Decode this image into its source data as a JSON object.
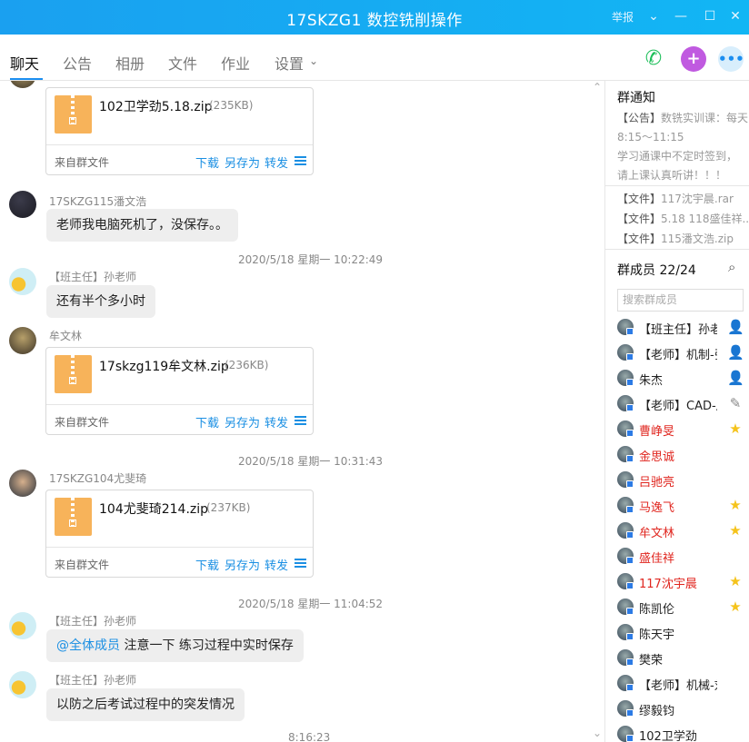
{
  "window": {
    "title": "17SKZG1 数控铣削操作",
    "report_label": "举报"
  },
  "tabs": [
    {
      "label": "聊天"
    },
    {
      "label": "公告"
    },
    {
      "label": "相册"
    },
    {
      "label": "文件"
    },
    {
      "label": "作业"
    },
    {
      "label": "设置"
    }
  ],
  "file_common": {
    "source": "来自群文件",
    "download": "下载",
    "save_as": "另存为",
    "forward": "转发"
  },
  "messages": {
    "file1": {
      "name": "102卫学劲5.18.zip",
      "size": "(235KB)"
    },
    "m2": {
      "sender": "17SKZG115潘文浩",
      "text": "老师我电脑死机了，没保存。。"
    },
    "t1": "2020/5/18 星期一 10:22:49",
    "m3": {
      "sender": "【班主任】孙老师",
      "text": "还有半个多小时"
    },
    "m4": {
      "sender": "牟文林",
      "file_name": "17skzg119牟文林.zip",
      "file_size": "(236KB)"
    },
    "t2": "2020/5/18 星期一 10:31:43",
    "m5": {
      "sender": "17SKZG104尤斐琦",
      "file_name": "104尤斐琦214.zip",
      "file_size": "(237KB)"
    },
    "t3": "2020/5/18 星期一 11:04:52",
    "m6": {
      "sender": "【班主任】孙老师",
      "mention": "@全体成员",
      "text": " 注意一下 练习过程中实时保存"
    },
    "m7": {
      "sender": "【班主任】孙老师",
      "text": "以防之后考试过程中的突发情况"
    },
    "t4": "8:16:23"
  },
  "notice": {
    "title": "群通知",
    "items": [
      {
        "tag": "【公告】",
        "text": "数铣实训课：每天"
      },
      {
        "tag": "",
        "text": "8:15～11:15"
      },
      {
        "tag": "",
        "text": "学习通课中不定时签到，"
      },
      {
        "tag": "",
        "text": "请上课认真听讲！！！"
      },
      {
        "tag": "【文件】",
        "text": "117沈宇晨.rar"
      },
      {
        "tag": "【文件】",
        "text": "5.18 118盛佳祥..."
      },
      {
        "tag": "【文件】",
        "text": "115潘文浩.zip"
      }
    ]
  },
  "members": {
    "title": "群成员 22/24",
    "search_placeholder": "搜索群成员",
    "list": [
      {
        "name": "【班主任】孙老师",
        "red": false,
        "icon": "person-icon"
      },
      {
        "name": "【老师】机制-张",
        "red": false,
        "icon": "person-icon"
      },
      {
        "name": "朱杰",
        "red": false,
        "icon": "person-icon"
      },
      {
        "name": "【老师】CAD-周",
        "red": false,
        "icon": "pencil-icon"
      },
      {
        "name": "曹峥旻",
        "red": true,
        "icon": "star-icon"
      },
      {
        "name": "金思诚",
        "red": true,
        "icon": ""
      },
      {
        "name": "吕驰亮",
        "red": true,
        "icon": ""
      },
      {
        "name": "马逸飞",
        "red": true,
        "icon": "star-icon"
      },
      {
        "name": "牟文林",
        "red": true,
        "icon": "star-icon"
      },
      {
        "name": "盛佳祥",
        "red": true,
        "icon": ""
      },
      {
        "name": "117沈宇晨",
        "red": true,
        "icon": "star-icon"
      },
      {
        "name": "陈凯伦",
        "red": false,
        "icon": "star-icon"
      },
      {
        "name": "陈天宇",
        "red": false,
        "icon": ""
      },
      {
        "name": "樊荣",
        "red": false,
        "icon": ""
      },
      {
        "name": "【老师】机械-刘老师",
        "red": false,
        "icon": ""
      },
      {
        "name": "缪毅钧",
        "red": false,
        "icon": ""
      },
      {
        "name": "102卫学劲",
        "red": false,
        "icon": ""
      }
    ]
  }
}
